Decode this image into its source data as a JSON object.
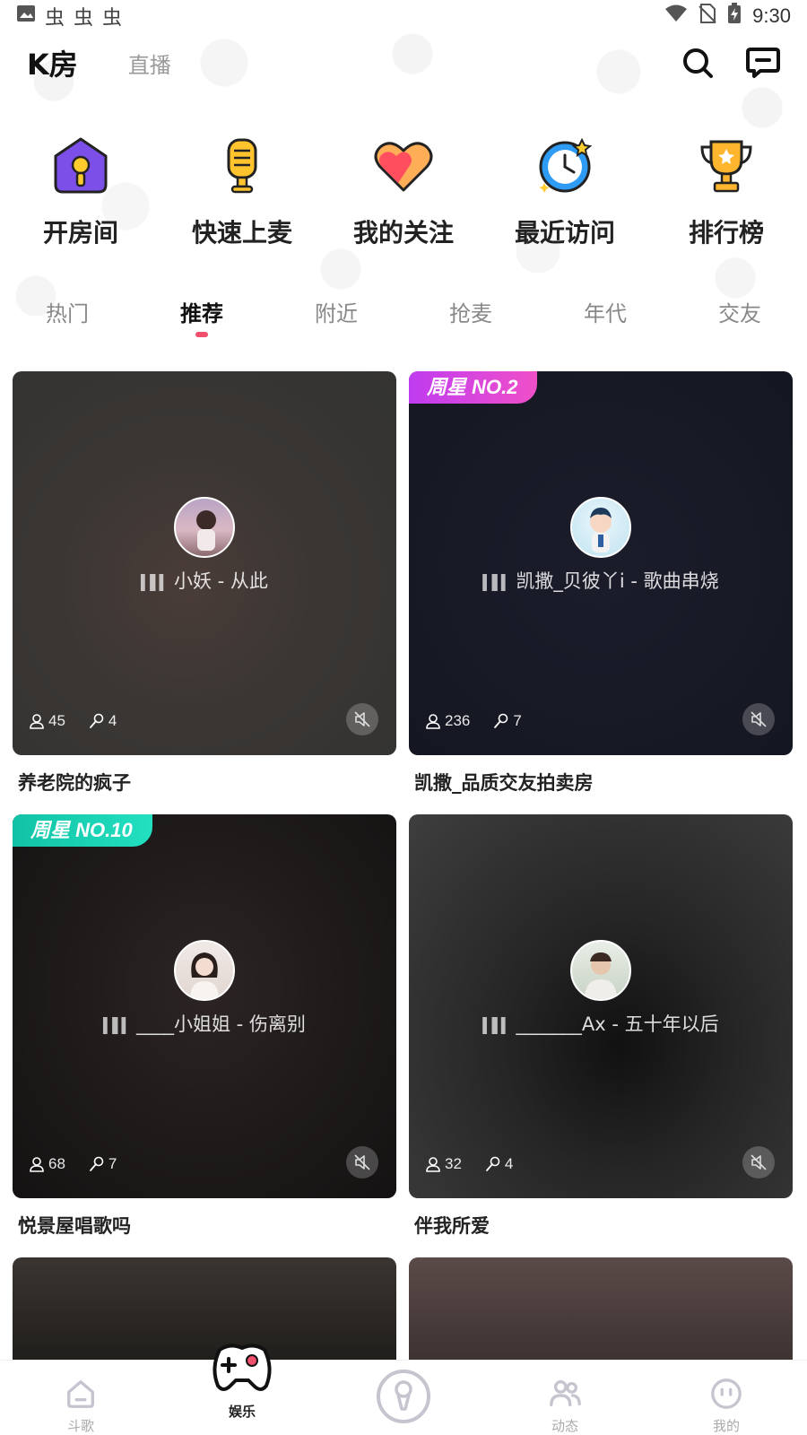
{
  "status_bar": {
    "left_glyphs": [
      "▲",
      "虫",
      "虫",
      "虫"
    ],
    "time": "9:30"
  },
  "header": {
    "tab_active": "K房",
    "tab_other": "直播"
  },
  "quick_actions": [
    {
      "label": "开房间",
      "icon": "house-mic-icon"
    },
    {
      "label": "快速上麦",
      "icon": "microphone-icon"
    },
    {
      "label": "我的关注",
      "icon": "heart-icon"
    },
    {
      "label": "最近访问",
      "icon": "clock-icon"
    },
    {
      "label": "排行榜",
      "icon": "trophy-icon"
    }
  ],
  "categories": [
    "热门",
    "推荐",
    "附近",
    "抢麦",
    "年代",
    "交友"
  ],
  "active_category": "推荐",
  "rooms": [
    {
      "title": "养老院的疯子",
      "song": "小妖 - 从此",
      "listeners": "45",
      "mics": "4",
      "badge": ""
    },
    {
      "title": "凯撒_品质交友拍卖房",
      "song": "凯撒_贝彼丫i - 歌曲串烧",
      "listeners": "236",
      "mics": "7",
      "badge": "周星 NO.2"
    },
    {
      "title": "悦景屋唱歌吗",
      "song": "____小姐姐 - 伤离别",
      "listeners": "68",
      "mics": "7",
      "badge": "周星 NO.10"
    },
    {
      "title": "伴我所爱",
      "song": "_______Ax - 五十年以后",
      "listeners": "32",
      "mics": "4",
      "badge": ""
    }
  ],
  "tab_bar": [
    {
      "label": "斗歌",
      "icon": "home-icon"
    },
    {
      "label": "娱乐",
      "icon": "gamepad-icon"
    },
    {
      "label": "",
      "icon": "microphone-center-icon"
    },
    {
      "label": "动态",
      "icon": "people-icon"
    },
    {
      "label": "我的",
      "icon": "smile-icon"
    }
  ],
  "colors": {
    "accent": "#f0506e",
    "badge_pink": "#e040c8",
    "badge_teal": "#19c9b0",
    "tab_icon": "#c5c5d0"
  }
}
